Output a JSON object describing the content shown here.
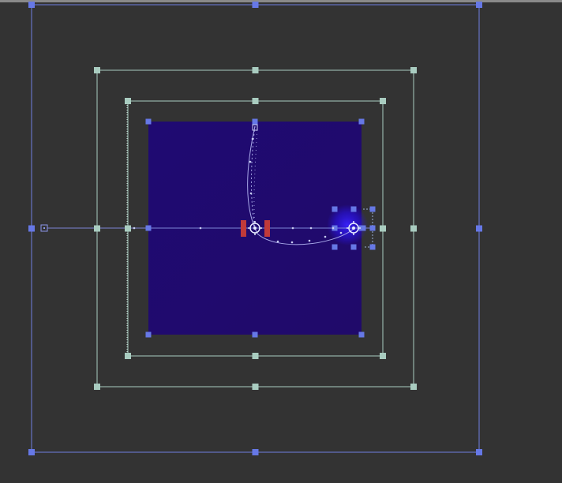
{
  "canvas": {
    "background": "#333333",
    "top_strip_color": "#8a8a8a"
  },
  "colors": {
    "outer_frame": "#6f7fe0",
    "inner_frames": "#a9ccc0",
    "handle_blue": "#6678e6",
    "handle_green": "#a9ccc0",
    "swatch_dark": "#1f0a6e",
    "swatch_light": "#2a0d8f",
    "pivot_red": "#c03a3a",
    "spline": "#a8a8e8",
    "glow": "#2a18ff"
  },
  "icons": [
    "canvas-origin-icon",
    "transform-pivot-icon",
    "gradient-end-icon"
  ]
}
